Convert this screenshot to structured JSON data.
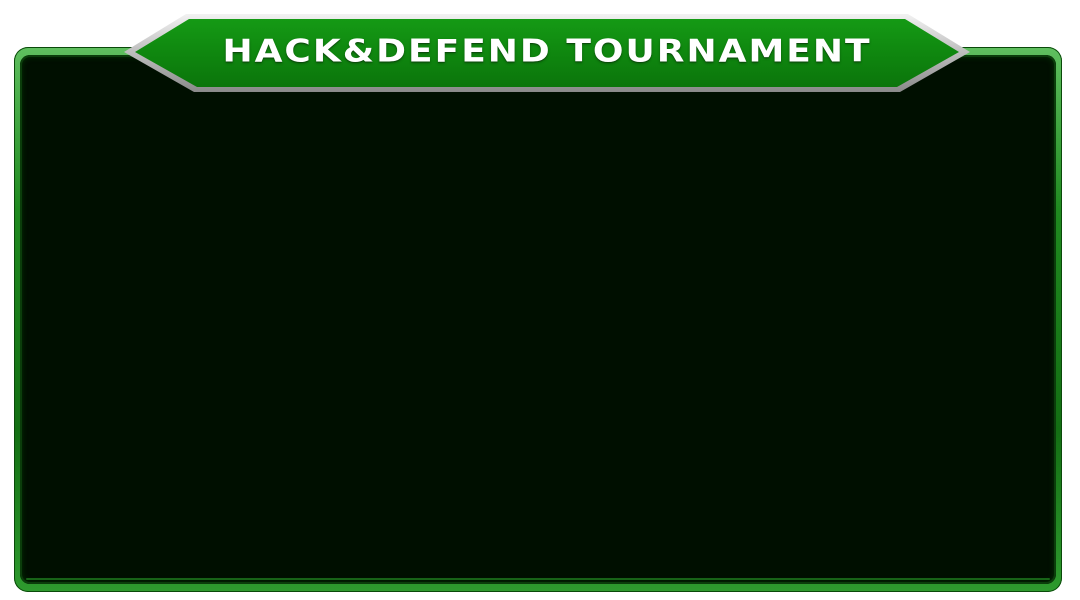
{
  "window": {
    "title": "HACK&DEFEND TOURNAMENT"
  },
  "colors": {
    "frame_green": "#1f8a1f",
    "frame_highlight": "#5fbf5f",
    "panel_background": "#000f00",
    "title_text": "#ffffff",
    "title_tab_green": "#118411"
  }
}
